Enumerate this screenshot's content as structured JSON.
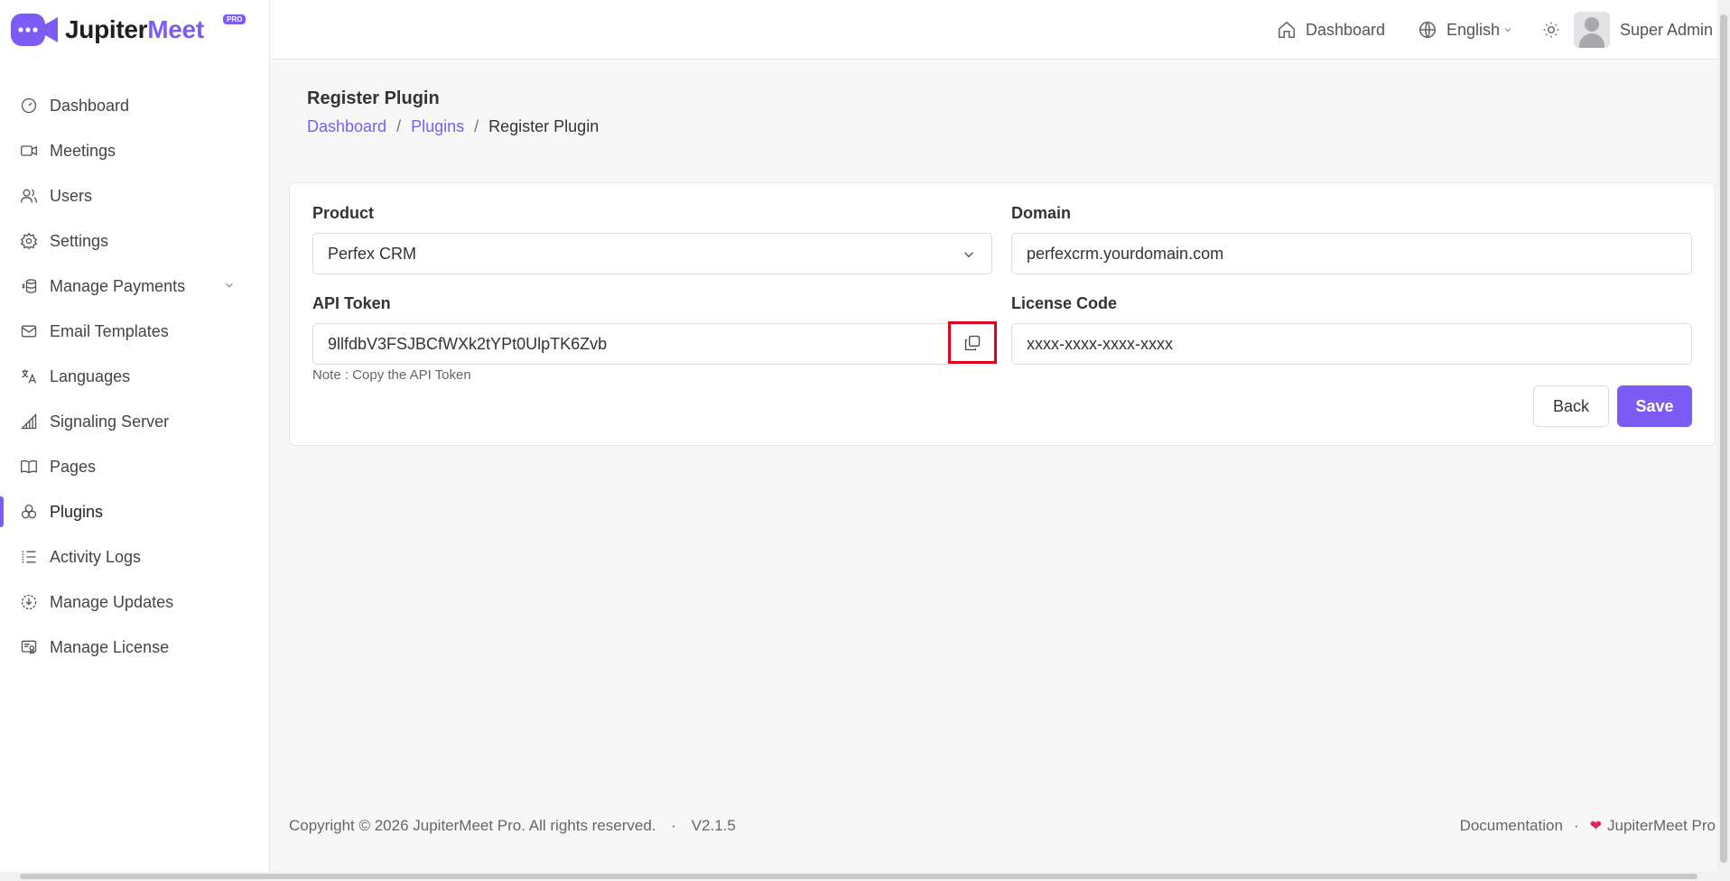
{
  "app": {
    "name_part1": "Jupiter",
    "name_part2": "Meet",
    "badge": "PRO",
    "brand_color": "#7c5cf4"
  },
  "sidebar": {
    "items": [
      {
        "label": "Dashboard",
        "icon": "gauge-icon"
      },
      {
        "label": "Meetings",
        "icon": "video-icon"
      },
      {
        "label": "Users",
        "icon": "users-icon"
      },
      {
        "label": "Settings",
        "icon": "gear-icon"
      },
      {
        "label": "Manage Payments",
        "icon": "coins-icon",
        "expandable": true
      },
      {
        "label": "Email Templates",
        "icon": "mail-icon"
      },
      {
        "label": "Languages",
        "icon": "translate-icon"
      },
      {
        "label": "Signaling Server",
        "icon": "signal-icon"
      },
      {
        "label": "Pages",
        "icon": "book-icon"
      },
      {
        "label": "Plugins",
        "icon": "plugins-icon",
        "active": true
      },
      {
        "label": "Activity Logs",
        "icon": "list-icon"
      },
      {
        "label": "Manage Updates",
        "icon": "download-circle-icon"
      },
      {
        "label": "Manage License",
        "icon": "license-icon"
      }
    ]
  },
  "topbar": {
    "dashboard_label": "Dashboard",
    "language_label": "English",
    "user_name": "Super Admin"
  },
  "page": {
    "title": "Register Plugin",
    "breadcrumb": [
      "Dashboard",
      "Plugins",
      "Register Plugin"
    ],
    "breadcrumb_sep": "/"
  },
  "form": {
    "product_label": "Product",
    "product_value": "Perfex CRM",
    "domain_label": "Domain",
    "domain_value": "perfexcrm.yourdomain.com",
    "api_token_label": "API Token",
    "api_token_value": "9llfdbV3FSJBCfWXk2tYPt0UlpTK6Zvb",
    "license_label": "License Code",
    "license_placeholder": "xxxx-xxxx-xxxx-xxxx",
    "note": "Note : Copy the API Token",
    "back_label": "Back",
    "save_label": "Save"
  },
  "footer": {
    "copyright": "Copyright © 2026 JupiterMeet Pro. All rights reserved.",
    "sep": "·",
    "version": "V2.1.5",
    "documentation": "Documentation",
    "brand": "JupiterMeet Pro"
  }
}
